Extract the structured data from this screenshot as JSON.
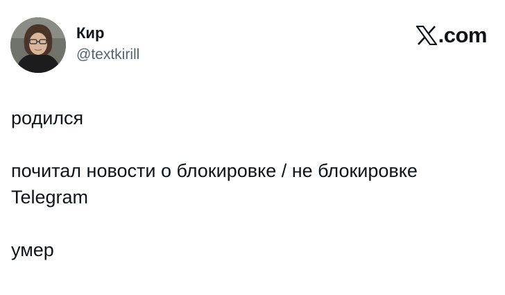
{
  "author": {
    "name": "Кир",
    "handle": "@textkirill"
  },
  "brand": {
    "label": ".com",
    "icon": "x-logo-icon"
  },
  "tweet": {
    "line_1": "родился",
    "line_2": "почитал новости о блокировке / не блокировке",
    "line_3": "Telegram",
    "line_4": "умер"
  },
  "colors": {
    "text_primary": "#0f1419",
    "text_secondary": "#536471",
    "background": "#ffffff"
  }
}
